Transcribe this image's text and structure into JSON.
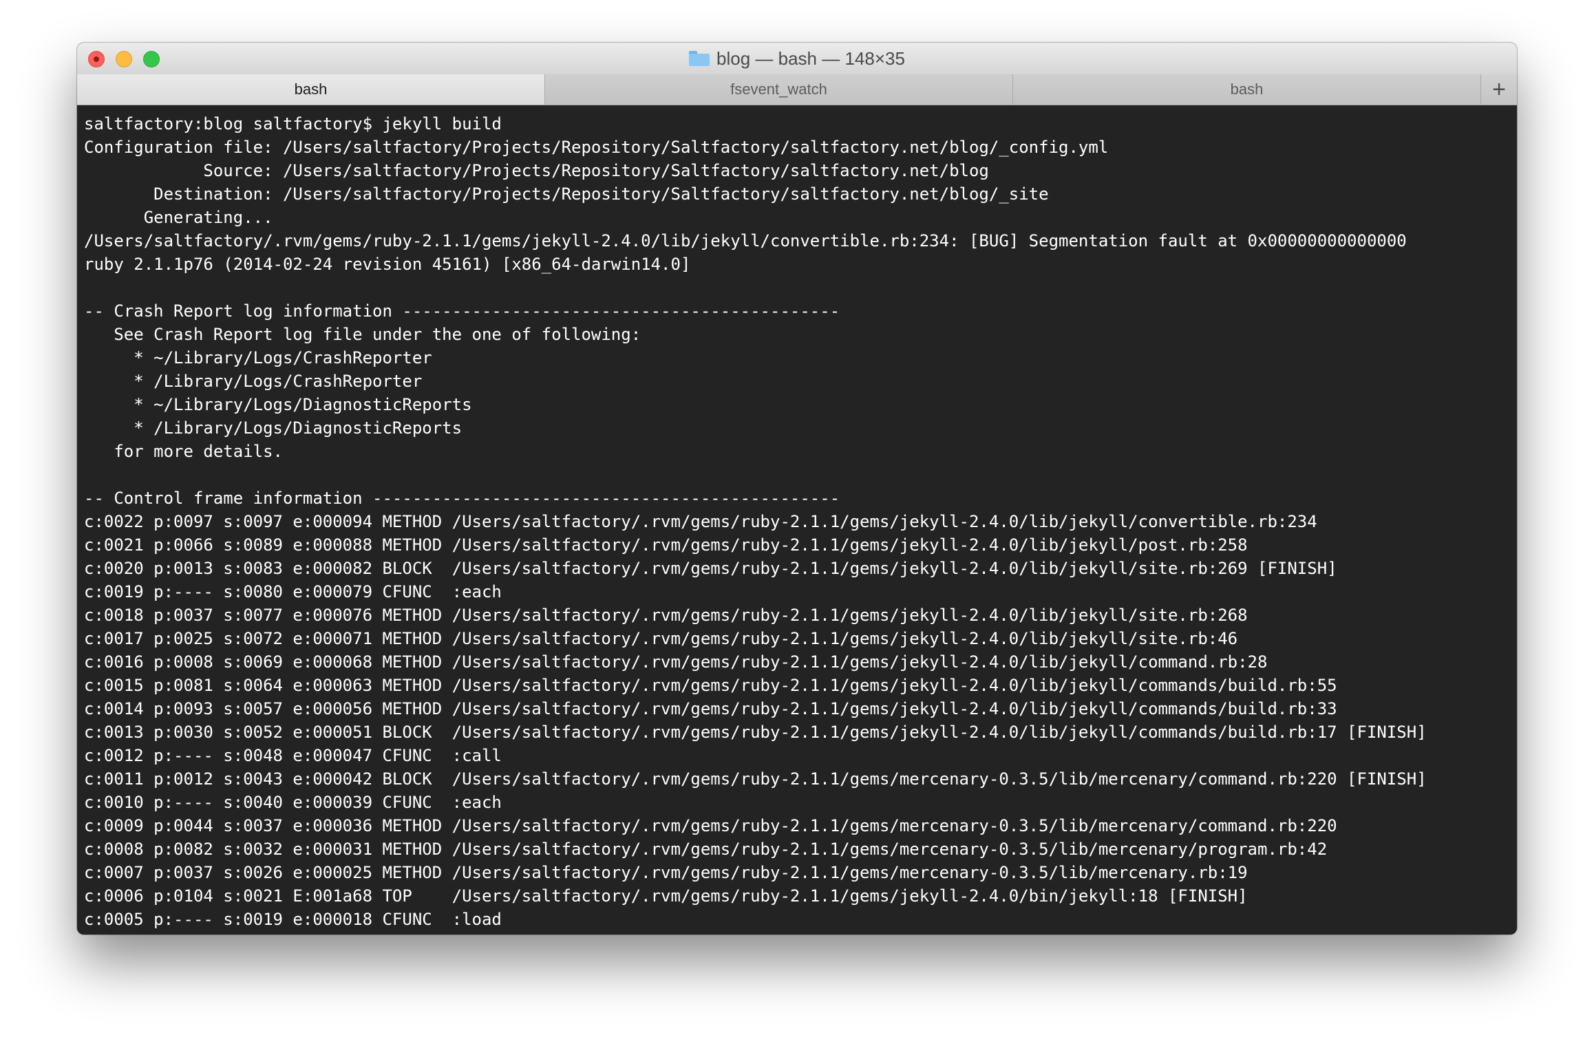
{
  "window": {
    "folder_icon": "folder-icon",
    "title": "blog — bash — 148×35"
  },
  "tabs": [
    {
      "label": "bash",
      "active": true
    },
    {
      "label": "fsevent_watch",
      "active": false
    },
    {
      "label": "bash",
      "active": false
    }
  ],
  "new_tab_label": "+",
  "terminal": {
    "lines": [
      "saltfactory:blog saltfactory$ jekyll build",
      "Configuration file: /Users/saltfactory/Projects/Repository/Saltfactory/saltfactory.net/blog/_config.yml",
      "            Source: /Users/saltfactory/Projects/Repository/Saltfactory/saltfactory.net/blog",
      "       Destination: /Users/saltfactory/Projects/Repository/Saltfactory/saltfactory.net/blog/_site",
      "      Generating...",
      "/Users/saltfactory/.rvm/gems/ruby-2.1.1/gems/jekyll-2.4.0/lib/jekyll/convertible.rb:234: [BUG] Segmentation fault at 0x00000000000000",
      "ruby 2.1.1p76 (2014-02-24 revision 45161) [x86_64-darwin14.0]",
      "",
      "-- Crash Report log information --------------------------------------------",
      "   See Crash Report log file under the one of following:",
      "     * ~/Library/Logs/CrashReporter",
      "     * /Library/Logs/CrashReporter",
      "     * ~/Library/Logs/DiagnosticReports",
      "     * /Library/Logs/DiagnosticReports",
      "   for more details.",
      "",
      "-- Control frame information -----------------------------------------------",
      "c:0022 p:0097 s:0097 e:000094 METHOD /Users/saltfactory/.rvm/gems/ruby-2.1.1/gems/jekyll-2.4.0/lib/jekyll/convertible.rb:234",
      "c:0021 p:0066 s:0089 e:000088 METHOD /Users/saltfactory/.rvm/gems/ruby-2.1.1/gems/jekyll-2.4.0/lib/jekyll/post.rb:258",
      "c:0020 p:0013 s:0083 e:000082 BLOCK  /Users/saltfactory/.rvm/gems/ruby-2.1.1/gems/jekyll-2.4.0/lib/jekyll/site.rb:269 [FINISH]",
      "c:0019 p:---- s:0080 e:000079 CFUNC  :each",
      "c:0018 p:0037 s:0077 e:000076 METHOD /Users/saltfactory/.rvm/gems/ruby-2.1.1/gems/jekyll-2.4.0/lib/jekyll/site.rb:268",
      "c:0017 p:0025 s:0072 e:000071 METHOD /Users/saltfactory/.rvm/gems/ruby-2.1.1/gems/jekyll-2.4.0/lib/jekyll/site.rb:46",
      "c:0016 p:0008 s:0069 e:000068 METHOD /Users/saltfactory/.rvm/gems/ruby-2.1.1/gems/jekyll-2.4.0/lib/jekyll/command.rb:28",
      "c:0015 p:0081 s:0064 e:000063 METHOD /Users/saltfactory/.rvm/gems/ruby-2.1.1/gems/jekyll-2.4.0/lib/jekyll/commands/build.rb:55",
      "c:0014 p:0093 s:0057 e:000056 METHOD /Users/saltfactory/.rvm/gems/ruby-2.1.1/gems/jekyll-2.4.0/lib/jekyll/commands/build.rb:33",
      "c:0013 p:0030 s:0052 e:000051 BLOCK  /Users/saltfactory/.rvm/gems/ruby-2.1.1/gems/jekyll-2.4.0/lib/jekyll/commands/build.rb:17 [FINISH]",
      "c:0012 p:---- s:0048 e:000047 CFUNC  :call",
      "c:0011 p:0012 s:0043 e:000042 BLOCK  /Users/saltfactory/.rvm/gems/ruby-2.1.1/gems/mercenary-0.3.5/lib/mercenary/command.rb:220 [FINISH]",
      "c:0010 p:---- s:0040 e:000039 CFUNC  :each",
      "c:0009 p:0044 s:0037 e:000036 METHOD /Users/saltfactory/.rvm/gems/ruby-2.1.1/gems/mercenary-0.3.5/lib/mercenary/command.rb:220",
      "c:0008 p:0082 s:0032 e:000031 METHOD /Users/saltfactory/.rvm/gems/ruby-2.1.1/gems/mercenary-0.3.5/lib/mercenary/program.rb:42",
      "c:0007 p:0037 s:0026 e:000025 METHOD /Users/saltfactory/.rvm/gems/ruby-2.1.1/gems/mercenary-0.3.5/lib/mercenary.rb:19",
      "c:0006 p:0104 s:0021 E:001a68 TOP    /Users/saltfactory/.rvm/gems/ruby-2.1.1/gems/jekyll-2.4.0/bin/jekyll:18 [FINISH]",
      "c:0005 p:---- s:0019 e:000018 CFUNC  :load"
    ]
  }
}
